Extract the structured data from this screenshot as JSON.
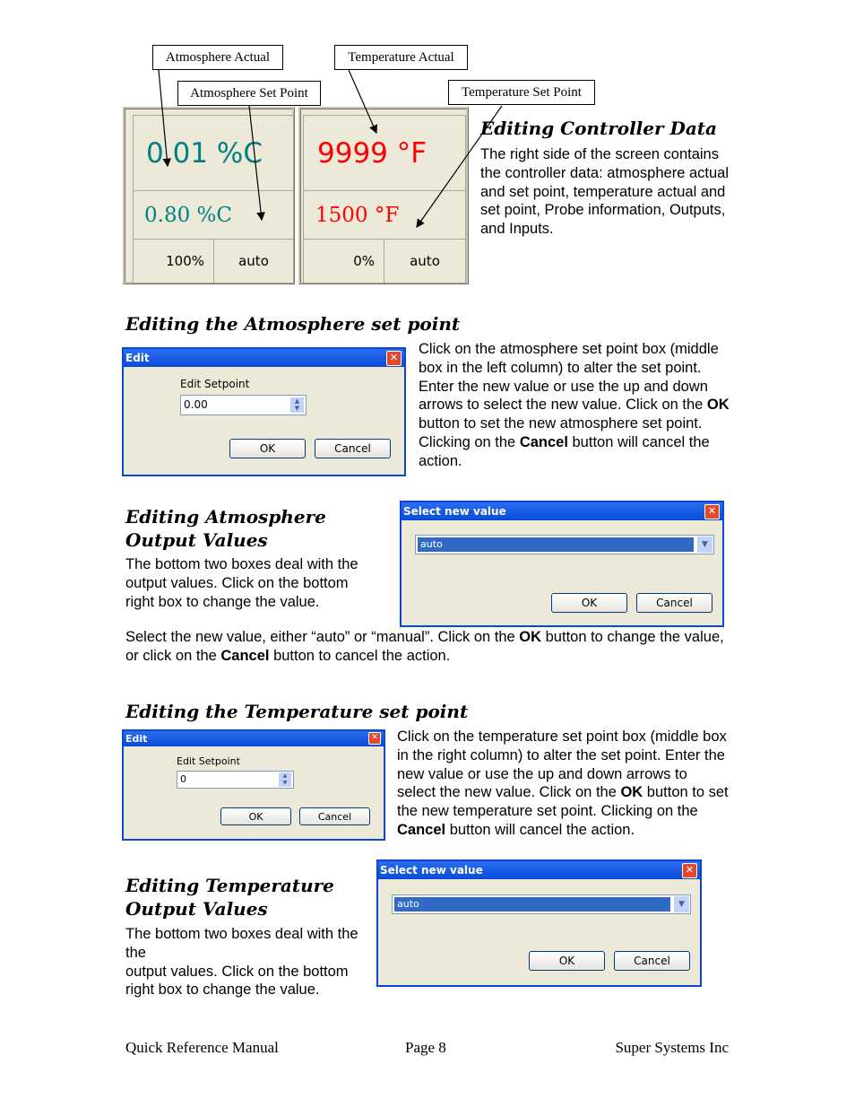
{
  "callouts": {
    "atm_actual": "Atmosphere Actual",
    "temp_actual": "Temperature Actual",
    "atm_setpoint": "Atmosphere Set Point",
    "temp_setpoint": "Temperature Set Point"
  },
  "panel": {
    "atm_actual": "0.01 %C",
    "atm_setpoint": "0.80 %C",
    "atm_output": "100%",
    "atm_mode": "auto",
    "temp_actual": "9999 °F",
    "temp_setpoint": "1500 °F",
    "temp_output": "0%",
    "temp_mode": "auto",
    "colors": {
      "atmosphere": "#008080",
      "temperature": "#ff0000"
    }
  },
  "s1": {
    "heading": "Editing Controller Data",
    "body": "The right side of the screen contains the controller data: atmosphere actual and set point, temperature actual and set point, Probe information, Outputs, and Inputs."
  },
  "s2": {
    "heading": "Editing the Atmosphere set point",
    "t1": "Click on the atmosphere set point box (middle box in the left column) to alter the set point. Enter the new value or use the up and down arrows to select the new value. Click on the ",
    "ok": "OK",
    "t2": " button to set the new atmosphere set point. Clicking on the ",
    "cancel": "Cancel",
    "t3": " button will cancel the action.",
    "dialog": {
      "title": "Edit",
      "label": "Edit Setpoint",
      "value": "0.00",
      "ok": "OK",
      "cancel": "Cancel"
    }
  },
  "s3": {
    "heading": "Editing Atmosphere Output Values",
    "body": "The bottom two boxes deal with the output values. Click on the bottom right box to change the value.",
    "t1": "Select the new value, either “auto” or “manual”. Click on the ",
    "ok": "OK",
    "t2": " button to change the value, or click on the ",
    "cancel": "Cancel",
    "t3": " button to cancel the action.",
    "dialog": {
      "title": "Select new value",
      "value": "auto",
      "ok": "OK",
      "cancel": "Cancel"
    }
  },
  "s4": {
    "heading": "Editing the Temperature set point",
    "t1": "Click on the temperature set point box (middle box in the right column) to alter the set point. Enter the new value or use the up and down arrows to select the new value. Click on the ",
    "ok": "OK",
    "t2": " button to set the new temperature set point. Clicking on the ",
    "cancel": "Cancel",
    "t3": " button will cancel the action.",
    "dialog": {
      "title": "Edit",
      "label": "Edit Setpoint",
      "value": "0",
      "ok": "OK",
      "cancel": "Cancel"
    }
  },
  "s5": {
    "heading": "Editing Temperature Output Values",
    "body": "The bottom two boxes deal with the\nthe\noutput values. Click on the bottom right box to change the value.",
    "dialog": {
      "title": "Select new value",
      "value": "auto",
      "ok": "OK",
      "cancel": "Cancel"
    }
  },
  "footer": {
    "left": "Quick Reference Manual",
    "center": "Page 8",
    "right": "Super Systems Inc"
  }
}
